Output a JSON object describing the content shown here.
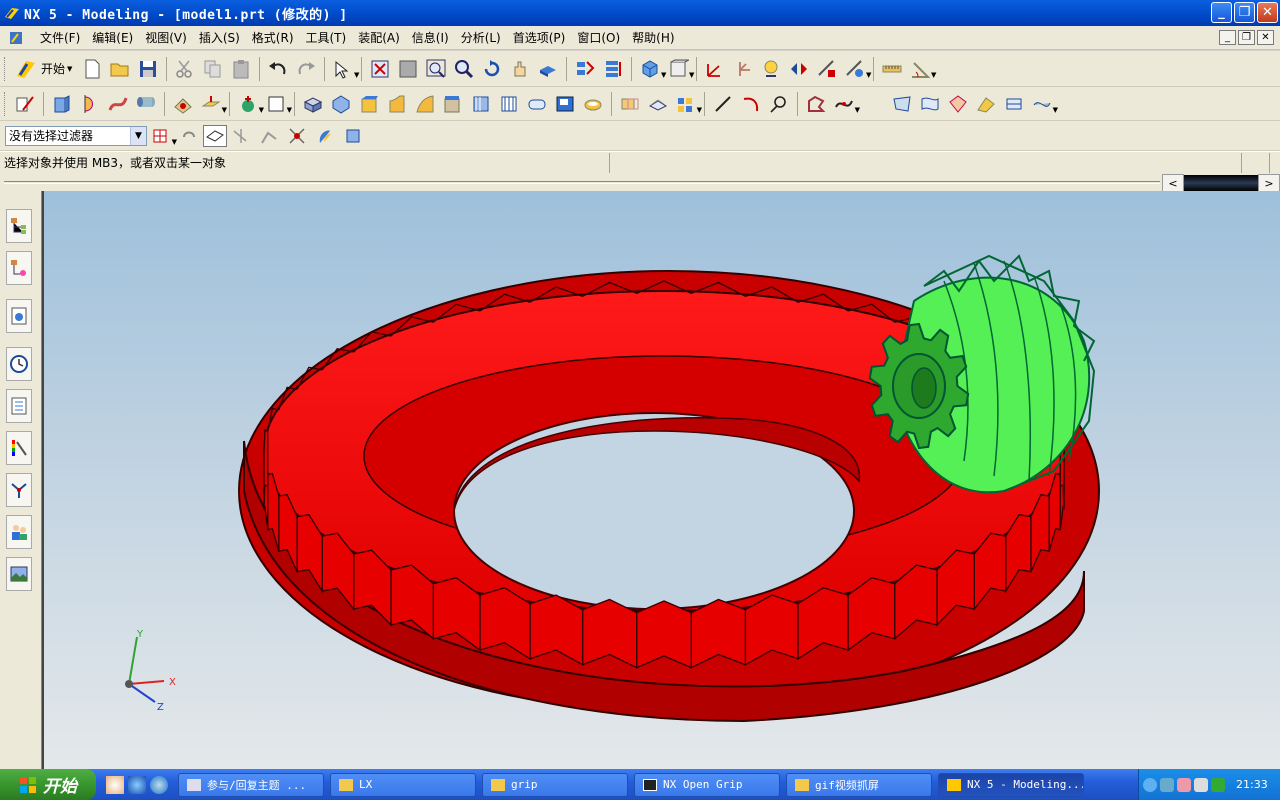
{
  "window": {
    "title": "NX 5 - Modeling - [model1.prt  (修改的) ]",
    "controls": [
      "minimize",
      "restore",
      "close"
    ]
  },
  "menu": {
    "items": [
      "文件(F)",
      "编辑(E)",
      "视图(V)",
      "插入(S)",
      "格式(R)",
      "工具(T)",
      "装配(A)",
      "信息(I)",
      "分析(L)",
      "首选项(P)",
      "窗口(O)",
      "帮助(H)"
    ]
  },
  "toolbar": {
    "start_label": "开始",
    "selection_filter": "没有选择过滤器"
  },
  "status": {
    "prompt": "选择对象并使用 MB3，或者双击某一对象"
  },
  "viewport": {
    "triad": {
      "x": "X",
      "y": "Y",
      "z": "Z"
    },
    "ring_gear_color": "#ff0000",
    "pinion_color": "#2ecc2e",
    "background_top": "#9ec0db",
    "background_bottom": "#e4e8ea"
  },
  "taskbar": {
    "start_label": "开始",
    "tasks": [
      {
        "label": "参与/回复主题 ..."
      },
      {
        "label": "LX"
      },
      {
        "label": "grip"
      },
      {
        "label": "NX Open Grip"
      },
      {
        "label": "gif视频抓屏"
      },
      {
        "label": "NX 5 - Modeling..."
      }
    ],
    "clock": "21:33"
  }
}
